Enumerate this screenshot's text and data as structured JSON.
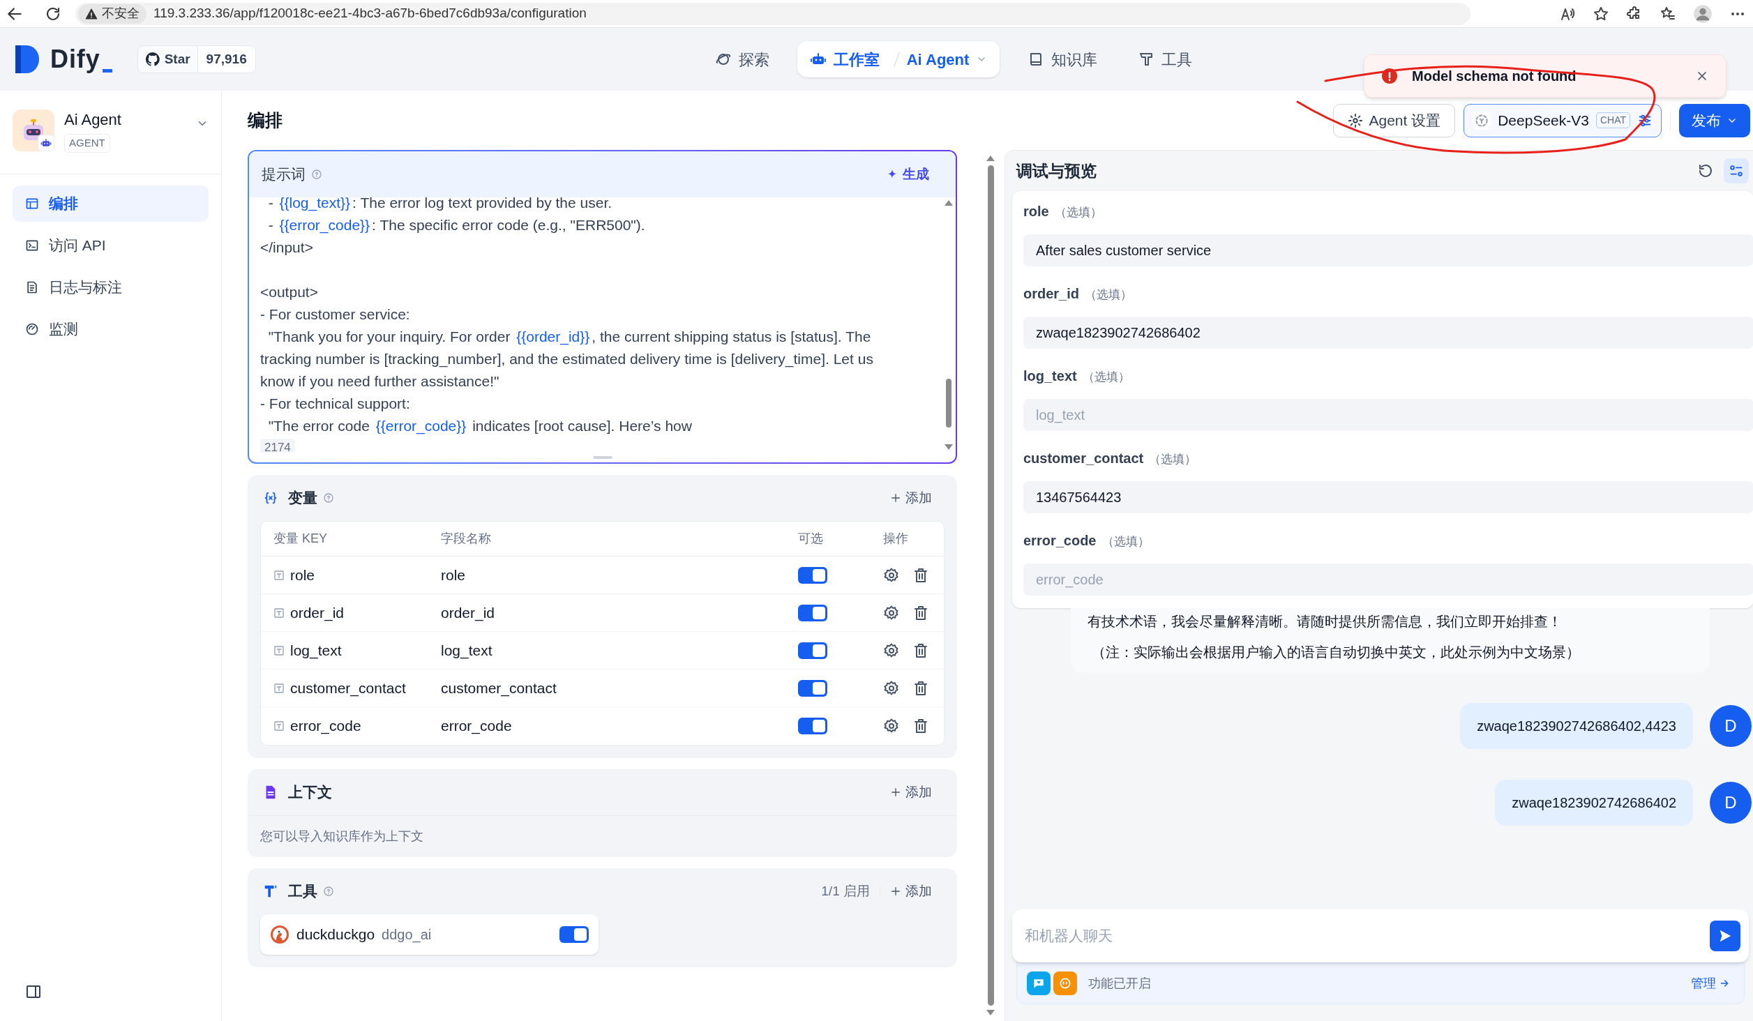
{
  "browser": {
    "security_label": "不安全",
    "url": "119.3.233.36/app/f120018c-ee21-4bc3-a67b-6bed7c6db93a/configuration"
  },
  "nav": {
    "logo": "Dify",
    "github": {
      "label": "Star",
      "count": "97,916"
    },
    "items": [
      {
        "label": "探索",
        "selected": false
      },
      {
        "label": "工作室",
        "selected": true,
        "sub": "Ai Agent"
      },
      {
        "label": "知识库",
        "selected": false
      },
      {
        "label": "工具",
        "selected": false
      }
    ]
  },
  "toast": {
    "message": "Model schema not found"
  },
  "app": {
    "name": "Ai Agent",
    "type": "AGENT"
  },
  "sidebar": {
    "items": [
      {
        "label": "编排",
        "selected": true
      },
      {
        "label": "访问 API",
        "selected": false
      },
      {
        "label": "日志与标注",
        "selected": false
      },
      {
        "label": "监测",
        "selected": false
      }
    ]
  },
  "page_title": "编排",
  "header_buttons": {
    "agent_settings": "Agent 设置",
    "model": "DeepSeek-V3",
    "model_badge": "CHAT",
    "publish": "发布"
  },
  "prompt": {
    "title": "提示词",
    "generate": "生成",
    "char_count": "2174",
    "lines": [
      {
        "segments": [
          {
            "kind": "plain",
            "text": "  - "
          },
          {
            "kind": "var",
            "text": "{{log_text}}"
          },
          {
            "kind": "plain",
            "text": ": The error log text provided by the user."
          }
        ]
      },
      {
        "segments": [
          {
            "kind": "plain",
            "text": "  - "
          },
          {
            "kind": "var",
            "text": "{{error_code}}"
          },
          {
            "kind": "plain",
            "text": ": The specific error code (e.g., \"ERR500\")."
          }
        ]
      },
      {
        "segments": [
          {
            "kind": "plain",
            "text": "</input>"
          }
        ]
      },
      {
        "gap_before": true,
        "segments": [
          {
            "kind": "plain",
            "text": "<output>"
          }
        ]
      },
      {
        "segments": [
          {
            "kind": "plain",
            "text": "- For customer service:"
          }
        ]
      },
      {
        "segments": [
          {
            "kind": "plain",
            "text": "  \"Thank you for your inquiry. For order "
          },
          {
            "kind": "var",
            "text": "{{order_id}}"
          },
          {
            "kind": "plain",
            "text": ", the current shipping status is [status]. The"
          }
        ]
      },
      {
        "segments": [
          {
            "kind": "plain",
            "text": "tracking number is [tracking_number], and the estimated delivery time is [delivery_time]. Let us"
          }
        ]
      },
      {
        "segments": [
          {
            "kind": "plain",
            "text": "know if you need further assistance!\""
          }
        ]
      },
      {
        "segments": [
          {
            "kind": "plain",
            "text": "- For technical support:"
          }
        ]
      },
      {
        "segments": [
          {
            "kind": "plain",
            "text": "  \"The error code "
          },
          {
            "kind": "var",
            "text": "{{error_code}}"
          },
          {
            "kind": "plain",
            "text": " indicates [root cause]. Here’s how"
          }
        ]
      }
    ]
  },
  "variables": {
    "title": "变量",
    "add": "添加",
    "columns": [
      "变量 KEY",
      "字段名称",
      "可选",
      "操作"
    ],
    "rows": [
      {
        "key": "role",
        "name": "role",
        "optional": true
      },
      {
        "key": "order_id",
        "name": "order_id",
        "optional": true
      },
      {
        "key": "log_text",
        "name": "log_text",
        "optional": true
      },
      {
        "key": "customer_contact",
        "name": "customer_contact",
        "optional": true
      },
      {
        "key": "error_code",
        "name": "error_code",
        "optional": true
      }
    ]
  },
  "context": {
    "title": "上下文",
    "add": "添加",
    "hint": "您可以导入知识库作为上下文"
  },
  "tools": {
    "title": "工具",
    "enabled_count": "1/1 启用",
    "add": "添加",
    "items": [
      {
        "name": "duckduckgo",
        "id": "ddgo_ai",
        "on": true
      }
    ]
  },
  "debug": {
    "title": "调试与预览",
    "inputs": [
      {
        "label": "role",
        "tag": "（选填）",
        "value": "After sales customer service"
      },
      {
        "label": "order_id",
        "tag": "（选填）",
        "value": "zwaqe1823902742686402"
      },
      {
        "label": "log_text",
        "tag": "（选填）",
        "placeholder": "log_text"
      },
      {
        "label": "customer_contact",
        "tag": "（选填）",
        "value": "13467564423"
      },
      {
        "label": "error_code",
        "tag": "（选填）",
        "placeholder": "error_code"
      }
    ],
    "messages": [
      {
        "kind": "bot",
        "lines": [
          "有技术术语，我会尽量解释清晰。请随时提供所需信息，我们立即开始排查！",
          "（注：实际输出会根据用户输入的语言自动切换中英文，此处示例为中文场景）"
        ]
      },
      {
        "kind": "user",
        "text": "zwaqe1823902742686402,4423",
        "avatar": "D"
      },
      {
        "kind": "user",
        "text": "zwaqe1823902742686402",
        "avatar": "D"
      }
    ],
    "chat_placeholder": "和机器人聊天",
    "features_label": "功能已开启",
    "manage": "管理"
  }
}
